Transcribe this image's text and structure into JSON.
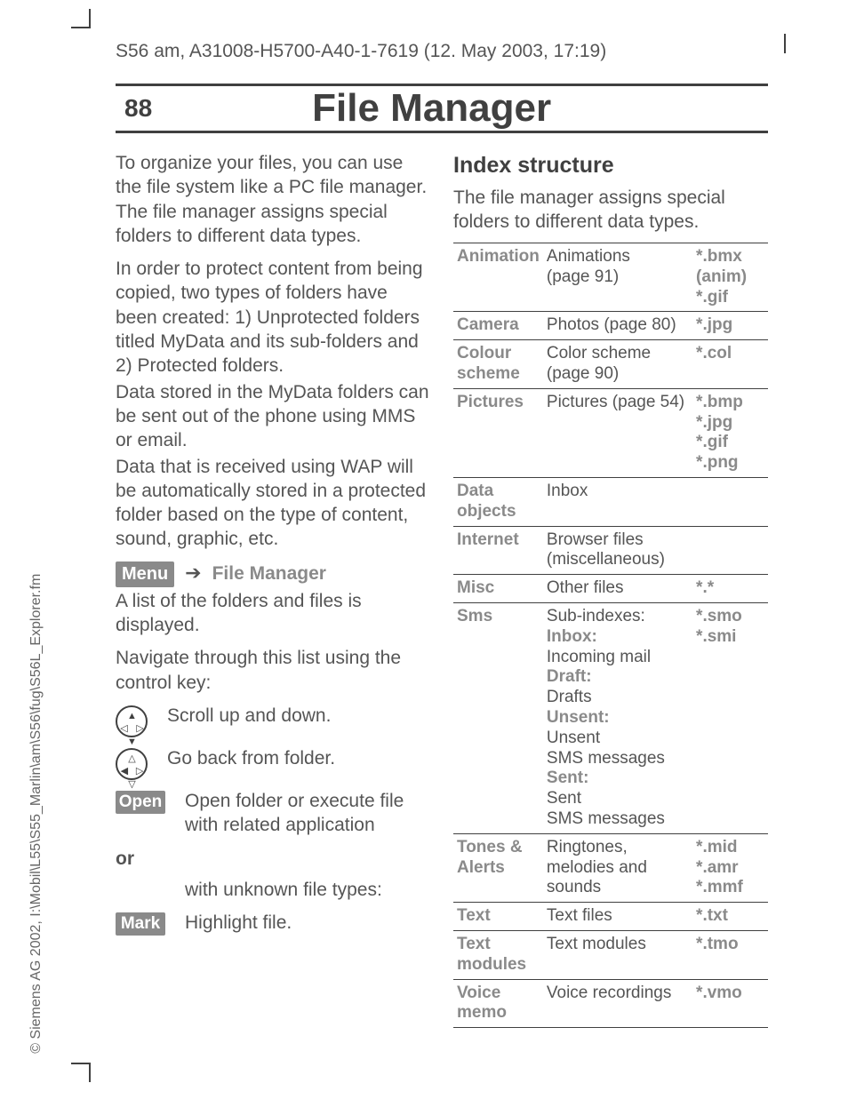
{
  "header": "S56 am, A31008-H5700-A40-1-7619 (12. May 2003, 17:19)",
  "page_num": "88",
  "page_title": "File Manager",
  "side_copyright": "© Siemens AG 2002, I:\\Mobil\\L55\\S55_Marlin\\am\\S56\\fug\\S56L_Explorer.fm",
  "left": {
    "p1": "To organize your files, you can use the file system like a PC file manager. The file manager assigns special folders to different data types.",
    "p2": "In order to protect content from being copied, two types of folders have been created: 1) Unprotected folders titled MyData and its sub-folders and 2) Protected folders.",
    "p3": "Data stored in the MyData folders can be sent out of the phone using MMS or email.",
    "p4": "Data that is received using WAP will be automatically stored in a protected folder based on the type of content, sound, graphic, etc.",
    "menu_label": "Menu",
    "menu_after": "File Manager",
    "p5": "A list of the folders and files is displayed.",
    "p6": "Navigate through this list using the control key:",
    "row1": "Scroll up and down.",
    "row2": "Go back from folder.",
    "open_label": "Open",
    "row3": "Open folder or execute file with related application",
    "or": "or",
    "row4_pre": "with unknown file types:",
    "mark_label": "Mark",
    "row4": "Highlight file."
  },
  "right": {
    "title": "Index structure",
    "intro": "The file manager assigns special folders to different data types."
  },
  "table": [
    {
      "c1": "Animation",
      "c2": "Animations\n(page 91)",
      "c3": "*.bmx\n(anim)\n*.gif"
    },
    {
      "c1": "Camera",
      "c2": "Photos (page 80)",
      "c3": "*.jpg"
    },
    {
      "c1": "Colour scheme",
      "c2": "Color scheme\n(page 90)",
      "c3": "*.col"
    },
    {
      "c1": "Pictures",
      "c2": "Pictures (page 54)",
      "c3": "*.bmp\n*.jpg\n*.gif\n*.png"
    },
    {
      "c1": "Data objects",
      "c2": "Inbox",
      "c3": ""
    },
    {
      "c1": "Internet",
      "c2": "Browser files\n(miscellaneous)",
      "c3": ""
    },
    {
      "c1": "Misc",
      "c2": "Other files",
      "c3": "*.*"
    },
    {
      "c1": "Sms",
      "c2": "Sub-indexes:",
      "c3": "*.smo\n*.smi",
      "subs": [
        {
          "h": "Inbox:",
          "t": "Incoming mail"
        },
        {
          "h": "Draft:",
          "t": "Drafts"
        },
        {
          "h": "Unsent:",
          "t": "Unsent\nSMS messages"
        },
        {
          "h": "Sent:",
          "t": "Sent\nSMS messages"
        }
      ]
    },
    {
      "c1": "Tones & Alerts",
      "c2": "Ringtones, melodies and sounds",
      "c3": "*.mid\n*.amr\n*.mmf"
    },
    {
      "c1": "Text",
      "c2": "Text files",
      "c3": "*.txt"
    },
    {
      "c1": "Text modules",
      "c2": "Text modules",
      "c3": "*.tmo"
    },
    {
      "c1": "Voice memo",
      "c2": "Voice recordings",
      "c3": "*.vmo"
    }
  ]
}
